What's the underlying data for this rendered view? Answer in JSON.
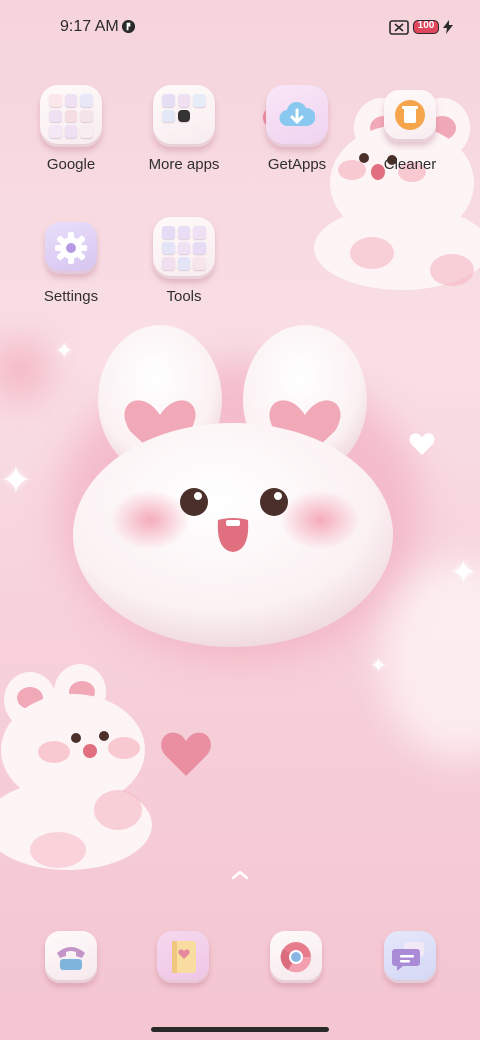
{
  "status": {
    "time": "9:17 AM",
    "battery_level": "100"
  },
  "apps": [
    {
      "label": "Google",
      "icon": "google-folder-icon"
    },
    {
      "label": "More apps",
      "icon": "more-apps-folder-icon"
    },
    {
      "label": "GetApps",
      "icon": "getapps-cloud-download-icon"
    },
    {
      "label": "Cleaner",
      "icon": "cleaner-trash-icon"
    },
    {
      "label": "Settings",
      "icon": "settings-gear-icon"
    },
    {
      "label": "Tools",
      "icon": "tools-folder-icon"
    }
  ],
  "dock": [
    {
      "icon": "phone-icon"
    },
    {
      "icon": "contacts-notebook-icon"
    },
    {
      "icon": "chrome-icon"
    },
    {
      "icon": "messages-icon"
    }
  ],
  "colors": {
    "wallpaper": "#f7d6de",
    "accent_pink": "#e58a9e",
    "label_text": "#2f2f2f"
  }
}
